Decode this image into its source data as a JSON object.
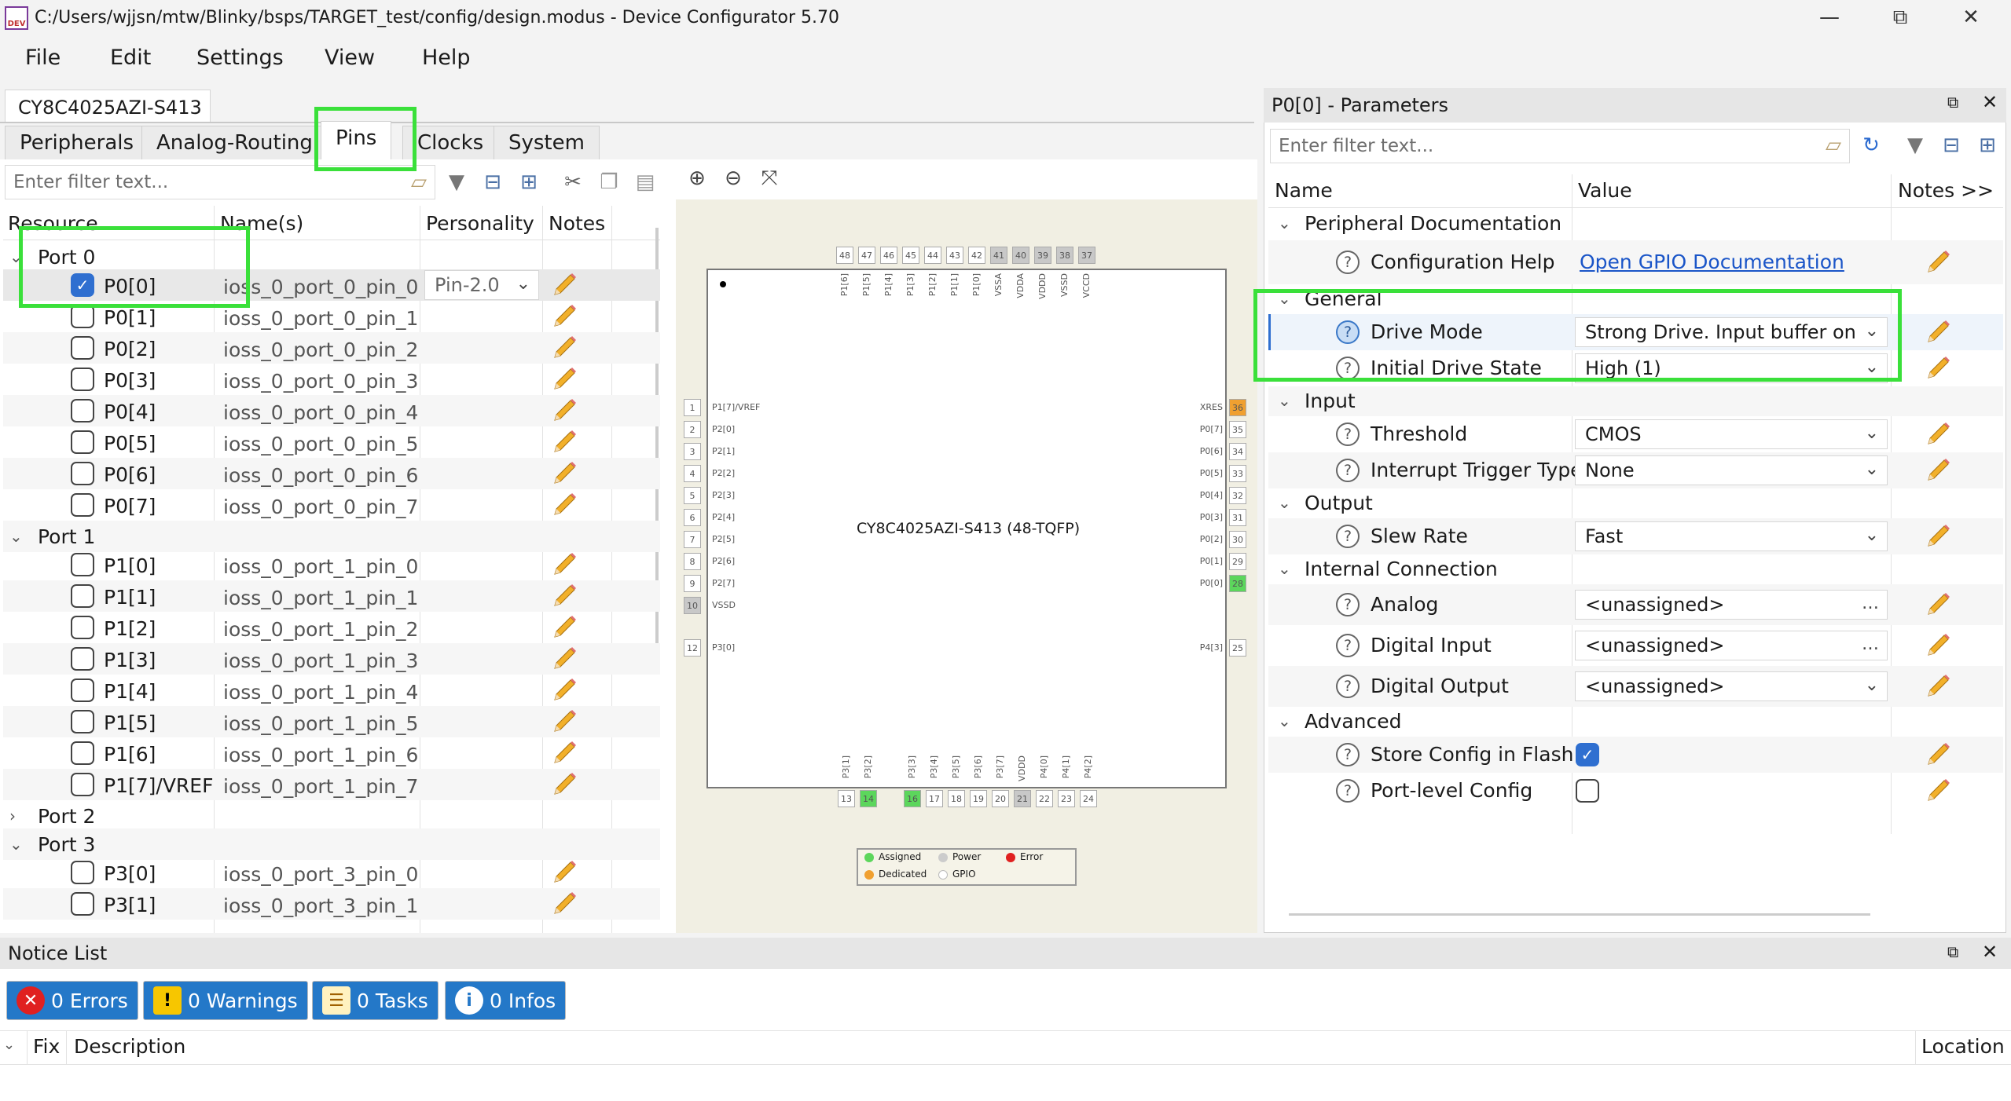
{
  "window": {
    "title": "C:/Users/wjjsn/mtw/Blinky/bsps/TARGET_test/config/design.modus - Device Configurator 5.70",
    "app_icon_text": "DEV",
    "minimize": "—",
    "maximize": "⧉",
    "close": "✕"
  },
  "menu": [
    "File",
    "Edit",
    "Settings",
    "View",
    "Help"
  ],
  "device_tab": "CY8C4025AZI-S413",
  "tabs": [
    "Peripherals",
    "Analog-Routing",
    "Pins",
    "Clocks",
    "System"
  ],
  "active_tab": "Pins",
  "left_filter_placeholder": "Enter filter text...",
  "tree_headers": {
    "resource": "Resource",
    "names": "Name(s)",
    "personality": "Personality",
    "notes": "Notes"
  },
  "ports": [
    {
      "label": "Port 0",
      "expanded": true,
      "pins": [
        {
          "label": "P0[0]",
          "name": "ioss_0_port_0_pin_0",
          "checked": true,
          "personality": "Pin-2.0"
        },
        {
          "label": "P0[1]",
          "name": "ioss_0_port_0_pin_1"
        },
        {
          "label": "P0[2]",
          "name": "ioss_0_port_0_pin_2"
        },
        {
          "label": "P0[3]",
          "name": "ioss_0_port_0_pin_3"
        },
        {
          "label": "P0[4]",
          "name": "ioss_0_port_0_pin_4"
        },
        {
          "label": "P0[5]",
          "name": "ioss_0_port_0_pin_5"
        },
        {
          "label": "P0[6]",
          "name": "ioss_0_port_0_pin_6"
        },
        {
          "label": "P0[7]",
          "name": "ioss_0_port_0_pin_7"
        }
      ]
    },
    {
      "label": "Port 1",
      "expanded": true,
      "pins": [
        {
          "label": "P1[0]",
          "name": "ioss_0_port_1_pin_0"
        },
        {
          "label": "P1[1]",
          "name": "ioss_0_port_1_pin_1"
        },
        {
          "label": "P1[2]",
          "name": "ioss_0_port_1_pin_2"
        },
        {
          "label": "P1[3]",
          "name": "ioss_0_port_1_pin_3"
        },
        {
          "label": "P1[4]",
          "name": "ioss_0_port_1_pin_4"
        },
        {
          "label": "P1[5]",
          "name": "ioss_0_port_1_pin_5"
        },
        {
          "label": "P1[6]",
          "name": "ioss_0_port_1_pin_6"
        },
        {
          "label": "P1[7]/VREF",
          "name": "ioss_0_port_1_pin_7"
        }
      ]
    },
    {
      "label": "Port 2",
      "expanded": false,
      "pins": []
    },
    {
      "label": "Port 3",
      "expanded": true,
      "pins": [
        {
          "label": "P3[0]",
          "name": "ioss_0_port_3_pin_0"
        },
        {
          "label": "P3[1]",
          "name": "ioss_0_port_3_pin_1"
        }
      ]
    }
  ],
  "chip": {
    "name": "CY8C4025AZI-S413 (48-TQFP)",
    "top_pins": [
      {
        "n": "48",
        "label": "P1[6]",
        "state": "normal"
      },
      {
        "n": "47",
        "label": "P1[5]",
        "state": "normal"
      },
      {
        "n": "46",
        "label": "P1[4]",
        "state": "normal"
      },
      {
        "n": "45",
        "label": "P1[3]",
        "state": "normal"
      },
      {
        "n": "44",
        "label": "P1[2]",
        "state": "normal"
      },
      {
        "n": "43",
        "label": "P1[1]",
        "state": "normal"
      },
      {
        "n": "42",
        "label": "P1[0]",
        "state": "normal"
      },
      {
        "n": "41",
        "label": "VSSA",
        "state": "gray"
      },
      {
        "n": "40",
        "label": "VDDA",
        "state": "gray"
      },
      {
        "n": "39",
        "label": "VDDD",
        "state": "gray"
      },
      {
        "n": "38",
        "label": "VSSD",
        "state": "gray"
      },
      {
        "n": "37",
        "label": "VCCD",
        "state": "gray"
      }
    ],
    "left_pins": [
      {
        "n": "1",
        "label": "P1[7]/VREF",
        "state": "normal"
      },
      {
        "n": "2",
        "label": "P2[0]",
        "state": "normal"
      },
      {
        "n": "3",
        "label": "P2[1]",
        "state": "normal"
      },
      {
        "n": "4",
        "label": "P2[2]",
        "state": "normal"
      },
      {
        "n": "5",
        "label": "P2[3]",
        "state": "normal"
      },
      {
        "n": "6",
        "label": "P2[4]",
        "state": "normal"
      },
      {
        "n": "7",
        "label": "P2[5]",
        "state": "normal"
      },
      {
        "n": "8",
        "label": "P2[6]",
        "state": "normal"
      },
      {
        "n": "9",
        "label": "P2[7]",
        "state": "normal"
      },
      {
        "n": "10",
        "label": "VSSD",
        "state": "gray"
      },
      {
        "n": "12",
        "label": "P3[0]",
        "state": "normal"
      }
    ],
    "right_pins": [
      {
        "n": "36",
        "label": "XRES",
        "state": "orange"
      },
      {
        "n": "35",
        "label": "P0[7]",
        "state": "normal"
      },
      {
        "n": "34",
        "label": "P0[6]",
        "state": "normal"
      },
      {
        "n": "33",
        "label": "P0[5]",
        "state": "normal"
      },
      {
        "n": "32",
        "label": "P0[4]",
        "state": "normal"
      },
      {
        "n": "31",
        "label": "P0[3]",
        "state": "normal"
      },
      {
        "n": "30",
        "label": "P0[2]",
        "state": "normal"
      },
      {
        "n": "29",
        "label": "P0[1]",
        "state": "normal"
      },
      {
        "n": "28",
        "label": "P0[0]",
        "state": "green"
      },
      {
        "n": "25",
        "label": "P4[3]",
        "state": "normal"
      }
    ],
    "bottom_pins": [
      {
        "n": "13",
        "label": "P3[1]",
        "state": "normal"
      },
      {
        "n": "14",
        "label": "P3[2]",
        "state": "green"
      },
      {
        "n": "16",
        "label": "P3[3]",
        "state": "green"
      },
      {
        "n": "17",
        "label": "P3[4]",
        "state": "normal"
      },
      {
        "n": "18",
        "label": "P3[5]",
        "state": "normal"
      },
      {
        "n": "19",
        "label": "P3[6]",
        "state": "normal"
      },
      {
        "n": "20",
        "label": "P3[7]",
        "state": "normal"
      },
      {
        "n": "21",
        "label": "VDDD",
        "state": "gray"
      },
      {
        "n": "22",
        "label": "P4[0]",
        "state": "normal"
      },
      {
        "n": "23",
        "label": "P4[1]",
        "state": "normal"
      },
      {
        "n": "24",
        "label": "P4[2]",
        "state": "normal"
      }
    ],
    "legend": {
      "assigned": "Assigned",
      "power": "Power",
      "error": "Error",
      "dedicated": "Dedicated",
      "gpio": "GPIO"
    }
  },
  "params_panel": {
    "title": "P0[0] - Parameters",
    "filter_placeholder": "Enter filter text...",
    "headers": {
      "name": "Name",
      "value": "Value",
      "notes": "Notes >>"
    },
    "groups": [
      {
        "label": "Peripheral Documentation",
        "rows": [
          {
            "name": "Configuration Help",
            "value": "Open GPIO Documentation",
            "kind": "link"
          }
        ]
      },
      {
        "label": "General",
        "rows": [
          {
            "name": "Drive Mode",
            "value": "Strong Drive. Input buffer on",
            "kind": "dropdown"
          },
          {
            "name": "Initial Drive State",
            "value": "High (1)",
            "kind": "dropdown"
          }
        ]
      },
      {
        "label": "Input",
        "rows": [
          {
            "name": "Threshold",
            "value": "CMOS",
            "kind": "dropdown"
          },
          {
            "name": "Interrupt Trigger Type",
            "value": "None",
            "kind": "dropdown"
          }
        ]
      },
      {
        "label": "Output",
        "rows": [
          {
            "name": "Slew Rate",
            "value": "Fast",
            "kind": "dropdown"
          }
        ]
      },
      {
        "label": "Internal Connection",
        "rows": [
          {
            "name": "Analog",
            "value": "<unassigned>",
            "kind": "picker"
          },
          {
            "name": "Digital Input",
            "value": "<unassigned>",
            "kind": "picker"
          },
          {
            "name": "Digital Output",
            "value": "<unassigned>",
            "kind": "dropdown"
          }
        ]
      },
      {
        "label": "Advanced",
        "rows": [
          {
            "name": "Store Config in Flash",
            "value": "",
            "kind": "checkbox",
            "checked": true
          },
          {
            "name": "Port-level Config",
            "value": "",
            "kind": "checkbox",
            "checked": false
          }
        ]
      }
    ]
  },
  "notice": {
    "title": "Notice List",
    "errors": "0 Errors",
    "warnings": "0 Warnings",
    "tasks": "0 Tasks",
    "infos": "0 Infos",
    "headers": {
      "fix": "Fix",
      "description": "Description",
      "location": "Location"
    }
  },
  "colors": {
    "accent": "#2f6fd0",
    "highlight": "#3ae03a",
    "notice_button": "#2478c8"
  }
}
